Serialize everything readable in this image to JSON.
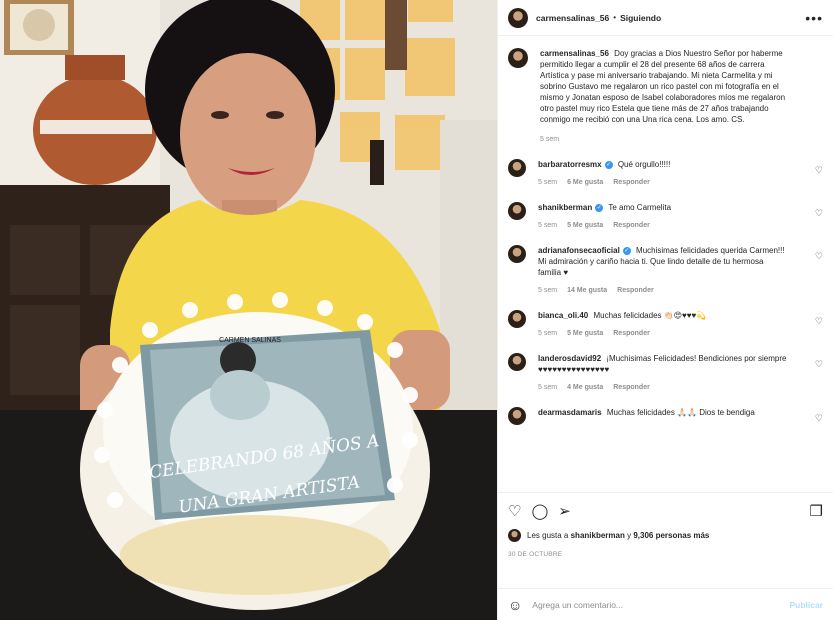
{
  "header": {
    "username": "carmensalinas_56",
    "separator": "•",
    "follow_status": "Siguiendo",
    "more_icon": "more-horizontal-icon"
  },
  "caption": {
    "username": "carmensalinas_56",
    "text": "Doy gracias a Dios Nuestro Señor por haberme permitido llegar a cumplir el 28 del presente 68 años de carrera Artística y pase mi aniversario trabajando. Mi nieta Carmelita y mi sobrino Gustavo me regalaron un rico pastel con mi fotografía en el mismo y Jonatan esposo de Isabel colaboradores míos me regalaron otro pastel muy rico Estela que tiene más de 27 años trabajando conmigo me recibió con una Una rica cena. Los amo. CS.",
    "time": "5 sem"
  },
  "comments": [
    {
      "username": "barbaratorresmx",
      "verified": true,
      "text": "Qué orgullo!!!!!",
      "time": "5 sem",
      "likes": "6 Me gusta",
      "reply": "Responder"
    },
    {
      "username": "shanikberman",
      "verified": true,
      "text": "Te amo Carmelita",
      "time": "5 sem",
      "likes": "5 Me gusta",
      "reply": "Responder"
    },
    {
      "username": "adrianafonsecaoficial",
      "verified": true,
      "text": "Muchisimas felicidades querida Carmen!!! Mi admiración y cariño hacia ti. Que lindo detalle de tu hermosa familia ♥",
      "time": "5 sem",
      "likes": "14 Me gusta",
      "reply": "Responder"
    },
    {
      "username": "bianca_oli.40",
      "verified": false,
      "text": "Muchas felicidades 👏🏻😍♥♥♥💫",
      "time": "5 sem",
      "likes": "5 Me gusta",
      "reply": "Responder"
    },
    {
      "username": "landerosdavid92",
      "verified": false,
      "text": "¡Muchisimas Felicidades! Bendiciones por siempre ♥♥♥♥♥♥♥♥♥♥♥♥♥♥♥",
      "time": "5 sem",
      "likes": "4 Me gusta",
      "reply": "Responder"
    },
    {
      "username": "dearmasdamaris",
      "verified": false,
      "text": "Muchas felicidades 🙏🏻🙏🏻 Dios te bendiga",
      "time": "",
      "likes": "",
      "reply": ""
    }
  ],
  "actions": {
    "like_icon": "heart-icon",
    "comment_icon": "comment-icon",
    "share_icon": "share-icon",
    "save_icon": "bookmark-icon"
  },
  "likes": {
    "prefix": "Les gusta a",
    "user": "shanikberman",
    "mid": "y",
    "count": "9,306 personas más"
  },
  "date": "30 DE OCTUBRE",
  "add_comment": {
    "placeholder": "Agrega un comentario...",
    "publish": "Publicar"
  },
  "photo": {
    "cake_text_1": "CELEBRANDO 68 AÑOS A",
    "cake_text_2": "UNA GRAN ARTISTA",
    "poster_text": "CARMEN SALINAS"
  }
}
